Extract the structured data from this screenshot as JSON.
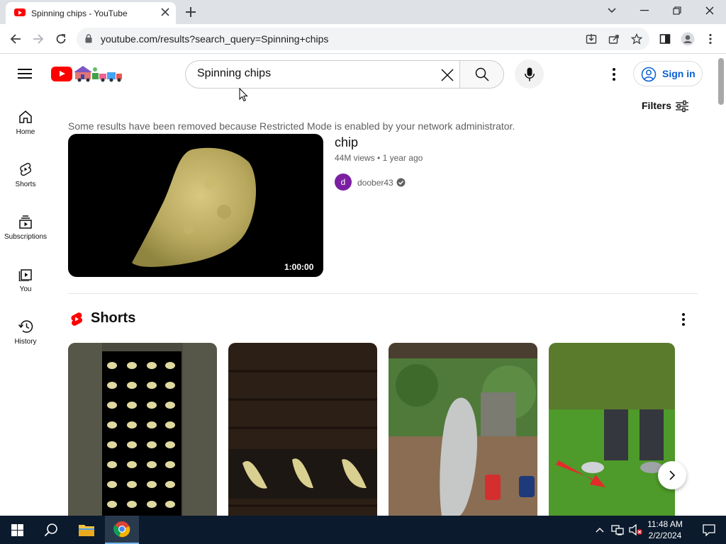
{
  "browser": {
    "tab_title": "Spinning chips - YouTube",
    "url": "youtube.com/results?search_query=Spinning+chips"
  },
  "header": {
    "search_value": "Spinning chips",
    "signin_label": "Sign in"
  },
  "sidebar": {
    "items": [
      {
        "label": "Home",
        "icon": "home-icon"
      },
      {
        "label": "Shorts",
        "icon": "shorts-icon"
      },
      {
        "label": "Subscriptions",
        "icon": "subscriptions-icon"
      },
      {
        "label": "You",
        "icon": "you-icon"
      },
      {
        "label": "History",
        "icon": "history-icon"
      }
    ]
  },
  "filters_label": "Filters",
  "notice": "Some results have been removed because Restricted Mode is enabled by your network administrator.",
  "video": {
    "title": "chip",
    "views": "44M views",
    "age": "1 year ago",
    "channel": "doober43",
    "channel_initial": "d",
    "duration": "1:00:00"
  },
  "shorts": {
    "title": "Shorts"
  },
  "taskbar": {
    "time": "11:48 AM",
    "date": "2/2/2024"
  },
  "colors": {
    "youtube_red": "#ff0000",
    "link_blue": "#065fd4",
    "taskbar": "#0b1a2c"
  }
}
